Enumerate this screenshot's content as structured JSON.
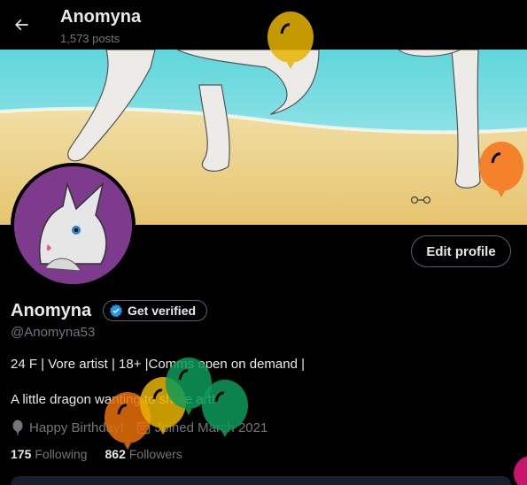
{
  "header": {
    "name": "Anomyna",
    "posts": "1,573 posts"
  },
  "profile": {
    "display_name": "Anomyna",
    "verify_label": "Get verified",
    "handle": "@Anomyna53",
    "edit_label": "Edit profile",
    "bio_line1": "24 F | Vore artist | 18+ |Comms open on demand |",
    "bio_line2": "A little dragon wanting to share art!",
    "birthday": "Happy Birthday!",
    "joined": "Joined March 2021",
    "following_count": "175",
    "following_label": "Following",
    "followers_count": "862",
    "followers_label": "Followers"
  },
  "icons": {
    "back": "back-arrow-icon",
    "verified": "verified-badge-icon",
    "birthday": "balloon-icon",
    "calendar": "calendar-icon"
  },
  "colors": {
    "background": "#000000",
    "text": "#e7e9ea",
    "muted": "#71767b",
    "verified": "#1d9bf0",
    "avatar_bg": "#7e3a8c",
    "balloon_yellow": "#e8b400",
    "balloon_orange": "#f4822b",
    "balloon_green": "#0e9a5a"
  }
}
